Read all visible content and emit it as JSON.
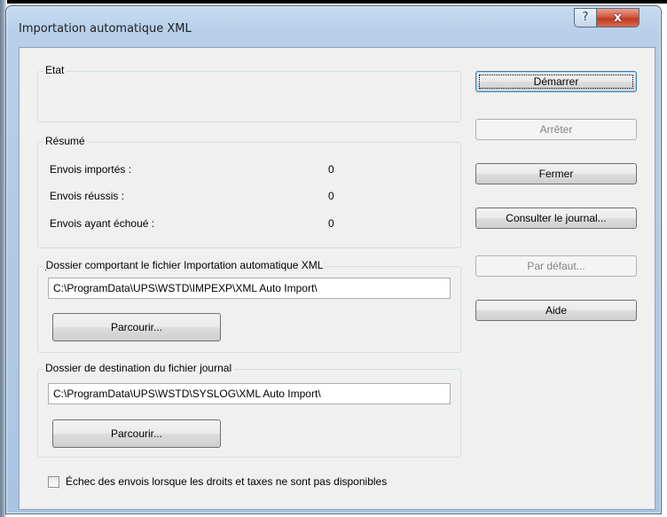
{
  "window": {
    "title": "Importation automatique XML",
    "help_glyph": "?",
    "close_glyph": "x"
  },
  "status_group": {
    "label": "Etat",
    "text": ""
  },
  "summary_group": {
    "label": "Résumé",
    "rows": [
      {
        "label": "Envois importés :",
        "value": "0"
      },
      {
        "label": "Envois réussis :",
        "value": "0"
      },
      {
        "label": "Envois ayant échoué :",
        "value": "0"
      }
    ]
  },
  "import_folder": {
    "label": "Dossier comportant le fichier Importation automatique XML",
    "path": "C:\\ProgramData\\UPS\\WSTD\\IMPEXP\\XML Auto Import\\",
    "browse_label": "Parcourir..."
  },
  "log_folder": {
    "label": "Dossier de destination du fichier journal",
    "path": "C:\\ProgramData\\UPS\\WSTD\\SYSLOG\\XML Auto Import\\",
    "browse_label": "Parcourir..."
  },
  "checkbox": {
    "label": "Échec des envois lorsque les droits et taxes ne sont pas disponibles",
    "checked": false
  },
  "buttons": {
    "start": "Démarrer",
    "stop": "Arrêter",
    "close": "Fermer",
    "view_log": "Consulter le journal...",
    "default": "Par défaut...",
    "help": "Aide"
  }
}
